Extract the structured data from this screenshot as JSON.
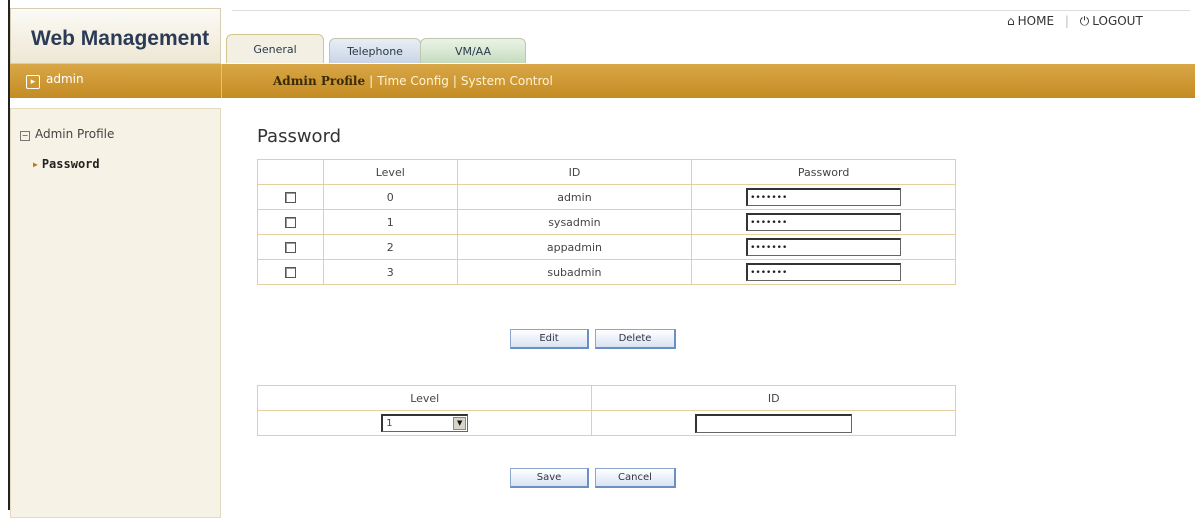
{
  "app": {
    "title": "Web Management"
  },
  "tabs": [
    {
      "label": "General"
    },
    {
      "label": "Telephone"
    },
    {
      "label": "VM/AA"
    }
  ],
  "toplinks": {
    "home": "HOME",
    "logout": "LOGOUT"
  },
  "user": {
    "name": "admin"
  },
  "subnav": [
    {
      "label": "Admin Profile",
      "active": true
    },
    {
      "label": "Time Config"
    },
    {
      "label": "System Control"
    }
  ],
  "sidebar": {
    "group": "Admin Profile",
    "items": [
      {
        "label": "Password"
      }
    ]
  },
  "page": {
    "title": "Password"
  },
  "password_table": {
    "headers": [
      "",
      "Level",
      "ID",
      "Password"
    ],
    "rows": [
      {
        "level": "0",
        "id": "admin",
        "password": "•••••••"
      },
      {
        "level": "1",
        "id": "sysadmin",
        "password": "•••••••"
      },
      {
        "level": "2",
        "id": "appadmin",
        "password": "•••••••"
      },
      {
        "level": "3",
        "id": "subadmin",
        "password": "•••••••"
      }
    ]
  },
  "buttons": {
    "edit": "Edit",
    "delete": "Delete",
    "save": "Save",
    "cancel": "Cancel"
  },
  "new_entry": {
    "headers": [
      "Level",
      "ID"
    ],
    "level_value": "1",
    "id_value": ""
  },
  "colors": {
    "goldbar": "#c9922c",
    "border": "#e3cfa0",
    "button": "#d8e3f3"
  }
}
